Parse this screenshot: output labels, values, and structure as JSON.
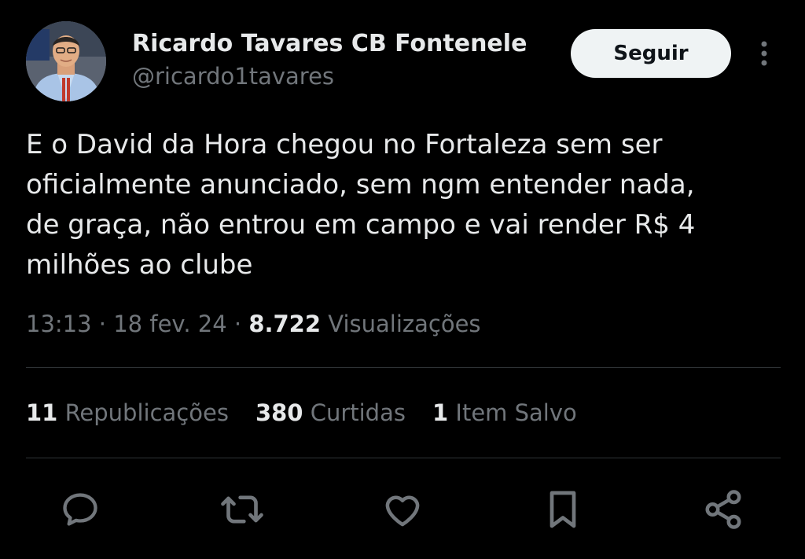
{
  "author": {
    "display_name": "Ricardo Tavares CB Fontenele",
    "handle": "@ricardo1tavares"
  },
  "follow_button_label": "Seguir",
  "tweet": {
    "lines": [
      "E o David da Hora chegou no Fortaleza sem ser",
      "oficialmente anunciado, sem ngm entender nada,",
      "de graça, não entrou em campo e vai render R$ 4",
      "milhões ao clube"
    ]
  },
  "meta": {
    "time": "13:13",
    "sep1": " · ",
    "date": "18 fev. 24",
    "sep2": " · ",
    "views_count": "8.722",
    "views_label": " Visualizações"
  },
  "stats": {
    "reposts_count": "11",
    "reposts_label": " Republicações",
    "likes_count": "380",
    "likes_label": " Curtidas",
    "bookmarks_count": "1",
    "bookmarks_label": " Item Salvo"
  },
  "actions": [
    "reply-icon",
    "repost-icon",
    "like-icon",
    "bookmark-icon",
    "share-icon"
  ],
  "colors": {
    "background": "#000000",
    "primary_text": "#e7e9ea",
    "secondary_text": "#71767b",
    "divider": "#2f3336",
    "follow_button_bg": "#eff3f4"
  }
}
